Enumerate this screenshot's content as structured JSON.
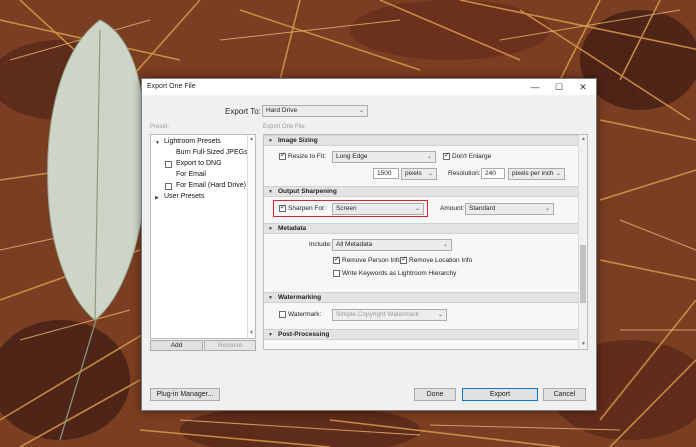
{
  "dialog": {
    "title": "Export One File",
    "controls": {
      "minimize": "—",
      "maximize": "☐",
      "close": "✕"
    }
  },
  "export_to": {
    "label": "Export To:",
    "value": "Hard Drive"
  },
  "preset_panel": {
    "label": "Preset:",
    "items": [
      {
        "label": "Lightroom Presets",
        "type": "group-open"
      },
      {
        "label": "Burn Full-Sized JPEGs",
        "type": "item"
      },
      {
        "label": "Export to DNG",
        "type": "checkbox",
        "checked": false
      },
      {
        "label": "For Email",
        "type": "item"
      },
      {
        "label": "For Email (Hard Drive)",
        "type": "checkbox",
        "checked": false
      },
      {
        "label": "User Presets",
        "type": "group-closed"
      }
    ],
    "add_label": "Add",
    "remove_label": "Remove"
  },
  "export_panel": {
    "label": "Export One File",
    "image_sizing": {
      "header": "Image Sizing",
      "resize_to_fit": {
        "label": "Resize to Fit:",
        "checked": true,
        "value": "Long Edge"
      },
      "dont_enlarge": {
        "label": "Don't Enlarge",
        "checked": true
      },
      "size_value": "1500",
      "size_unit": "pixels",
      "resolution_label": "Resolution:",
      "resolution_value": "240",
      "resolution_unit": "pixels per inch"
    },
    "output_sharpening": {
      "header": "Output Sharpening",
      "sharpen_for": {
        "label": "Sharpen For:",
        "checked": true,
        "value": "Screen"
      },
      "amount_label": "Amount:",
      "amount_value": "Standard"
    },
    "metadata": {
      "header": "Metadata",
      "include_label": "Include:",
      "include_value": "All Metadata",
      "remove_person": {
        "label": "Remove Person Info",
        "checked": true
      },
      "remove_location": {
        "label": "Remove Location Info",
        "checked": true
      },
      "write_keywords": {
        "label": "Write Keywords as Lightroom Hierarchy",
        "checked": false
      }
    },
    "watermarking": {
      "header": "Watermarking",
      "watermark": {
        "label": "Watermark:",
        "checked": false,
        "value": "Simple Copyright Watermark"
      }
    },
    "post_processing": {
      "header": "Post-Processing"
    }
  },
  "footer": {
    "plugin_manager": "Plug-in Manager...",
    "done": "Done",
    "export": "Export",
    "cancel": "Cancel"
  },
  "colors": {
    "accent": "#0078d7",
    "highlight": "#d9262c"
  }
}
